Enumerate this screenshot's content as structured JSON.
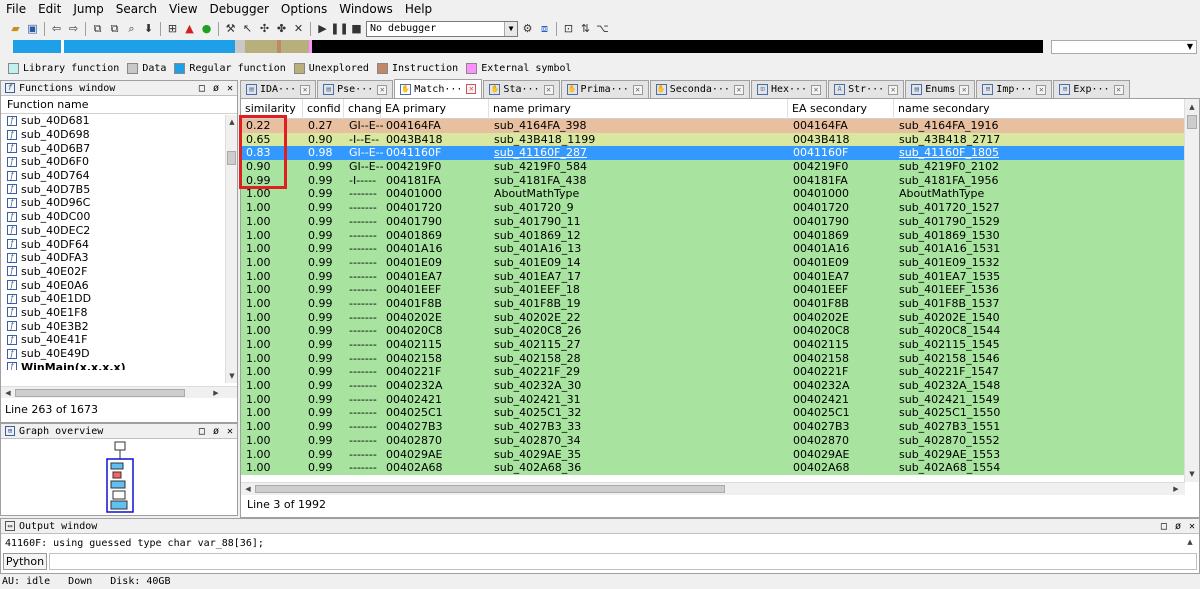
{
  "menu": [
    "File",
    "Edit",
    "Jump",
    "Search",
    "View",
    "Debugger",
    "Options",
    "Windows",
    "Help"
  ],
  "toolbar": {
    "debugger_value": "No debugger"
  },
  "colors": {
    "library_function": "#c0f0f0",
    "data": "#c8c8c8",
    "regular_function": "#1ea0e8",
    "unexplored": "#b8b07c",
    "instruction": "#c08868",
    "external_symbol": "#ff90ff",
    "row_green": "#a8e4a0",
    "row_orange": "#e8c0a0",
    "row_yellow": "#d8e8a0",
    "row_selected": "#3399ff",
    "highlight": "#e02020"
  },
  "legend": [
    {
      "label": "Library function",
      "color": "#c0f0f0"
    },
    {
      "label": "Data",
      "color": "#c8c8c8"
    },
    {
      "label": "Regular function",
      "color": "#1ea0e8"
    },
    {
      "label": "Unexplored",
      "color": "#b8b07c"
    },
    {
      "label": "Instruction",
      "color": "#c08868"
    },
    {
      "label": "External symbol",
      "color": "#ff90ff"
    }
  ],
  "functions_panel": {
    "title": "Functions window",
    "column": "Function name",
    "items": [
      "sub_40D681",
      "sub_40D698",
      "sub_40D6B7",
      "sub_40D6F0",
      "sub_40D764",
      "sub_40D7B5",
      "sub_40D96C",
      "sub_40DC00",
      "sub_40DEC2",
      "sub_40DF64",
      "sub_40DFA3",
      "sub_40E02F",
      "sub_40E0A6",
      "sub_40E1DD",
      "sub_40E1F8",
      "sub_40E3B2",
      "sub_40E41F",
      "sub_40E49D",
      "WinMain(x,x,x,x)"
    ],
    "status": "Line 263 of 1673"
  },
  "graph_panel": {
    "title": "Graph overview"
  },
  "tabs": [
    {
      "label": "IDA···",
      "icon": "ida-view-icon",
      "active": false
    },
    {
      "label": "Pse···",
      "icon": "pseudocode-icon",
      "active": false
    },
    {
      "label": "Match···",
      "icon": "match-icon",
      "active": true
    },
    {
      "label": "Sta···",
      "icon": "statistics-icon",
      "active": false
    },
    {
      "label": "Prima···",
      "icon": "primary-icon",
      "active": false
    },
    {
      "label": "Seconda···",
      "icon": "secondary-icon",
      "active": false
    },
    {
      "label": "Hex···",
      "icon": "hex-icon",
      "active": false
    },
    {
      "label": "Str···",
      "icon": "strings-icon",
      "active": false
    },
    {
      "label": "Enums",
      "icon": "enums-icon",
      "active": false
    },
    {
      "label": "Imp···",
      "icon": "imports-icon",
      "active": false
    },
    {
      "label": "Exp···",
      "icon": "exports-icon",
      "active": false
    }
  ],
  "match_table": {
    "columns": [
      "similarity",
      "confid",
      "chang",
      "EA primary",
      "name primary",
      "EA secondary",
      "name secondary"
    ],
    "rows": [
      {
        "similarity": "0.22",
        "confid": "0.27",
        "chang": "GI--E--",
        "ea_primary": "004164FA",
        "name_primary": "sub_4164FA_398",
        "ea_secondary": "004164FA",
        "name_secondary": "sub_4164FA_1916",
        "color": "orange"
      },
      {
        "similarity": "0.65",
        "confid": "0.90",
        "chang": "-I--E--",
        "ea_primary": "0043B418",
        "name_primary": "sub_43B418_1199",
        "ea_secondary": "0043B418",
        "name_secondary": "sub_43B418_2717",
        "color": "yellow"
      },
      {
        "similarity": "0.83",
        "confid": "0.98",
        "chang": "GI--E--",
        "ea_primary": "0041160F",
        "name_primary": "sub_41160F_287",
        "ea_secondary": "0041160F",
        "name_secondary": "sub_41160F_1805",
        "color": "selected"
      },
      {
        "similarity": "0.90",
        "confid": "0.99",
        "chang": "GI--E--",
        "ea_primary": "004219F0",
        "name_primary": "sub_4219F0_584",
        "ea_secondary": "004219F0",
        "name_secondary": "sub_4219F0_2102",
        "color": "green"
      },
      {
        "similarity": "0.99",
        "confid": "0.99",
        "chang": "-I-----",
        "ea_primary": "004181FA",
        "name_primary": "sub_4181FA_438",
        "ea_secondary": "004181FA",
        "name_secondary": "sub_4181FA_1956",
        "color": "green"
      },
      {
        "similarity": "1.00",
        "confid": "0.99",
        "chang": "-------",
        "ea_primary": "00401000",
        "name_primary": "AboutMathType",
        "ea_secondary": "00401000",
        "name_secondary": "AboutMathType",
        "color": "green"
      },
      {
        "similarity": "1.00",
        "confid": "0.99",
        "chang": "-------",
        "ea_primary": "00401720",
        "name_primary": "sub_401720_9",
        "ea_secondary": "00401720",
        "name_secondary": "sub_401720_1527",
        "color": "green"
      },
      {
        "similarity": "1.00",
        "confid": "0.99",
        "chang": "-------",
        "ea_primary": "00401790",
        "name_primary": "sub_401790_11",
        "ea_secondary": "00401790",
        "name_secondary": "sub_401790_1529",
        "color": "green"
      },
      {
        "similarity": "1.00",
        "confid": "0.99",
        "chang": "-------",
        "ea_primary": "00401869",
        "name_primary": "sub_401869_12",
        "ea_secondary": "00401869",
        "name_secondary": "sub_401869_1530",
        "color": "green"
      },
      {
        "similarity": "1.00",
        "confid": "0.99",
        "chang": "-------",
        "ea_primary": "00401A16",
        "name_primary": "sub_401A16_13",
        "ea_secondary": "00401A16",
        "name_secondary": "sub_401A16_1531",
        "color": "green"
      },
      {
        "similarity": "1.00",
        "confid": "0.99",
        "chang": "-------",
        "ea_primary": "00401E09",
        "name_primary": "sub_401E09_14",
        "ea_secondary": "00401E09",
        "name_secondary": "sub_401E09_1532",
        "color": "green"
      },
      {
        "similarity": "1.00",
        "confid": "0.99",
        "chang": "-------",
        "ea_primary": "00401EA7",
        "name_primary": "sub_401EA7_17",
        "ea_secondary": "00401EA7",
        "name_secondary": "sub_401EA7_1535",
        "color": "green"
      },
      {
        "similarity": "1.00",
        "confid": "0.99",
        "chang": "-------",
        "ea_primary": "00401EEF",
        "name_primary": "sub_401EEF_18",
        "ea_secondary": "00401EEF",
        "name_secondary": "sub_401EEF_1536",
        "color": "green"
      },
      {
        "similarity": "1.00",
        "confid": "0.99",
        "chang": "-------",
        "ea_primary": "00401F8B",
        "name_primary": "sub_401F8B_19",
        "ea_secondary": "00401F8B",
        "name_secondary": "sub_401F8B_1537",
        "color": "green"
      },
      {
        "similarity": "1.00",
        "confid": "0.99",
        "chang": "-------",
        "ea_primary": "0040202E",
        "name_primary": "sub_40202E_22",
        "ea_secondary": "0040202E",
        "name_secondary": "sub_40202E_1540",
        "color": "green"
      },
      {
        "similarity": "1.00",
        "confid": "0.99",
        "chang": "-------",
        "ea_primary": "004020C8",
        "name_primary": "sub_4020C8_26",
        "ea_secondary": "004020C8",
        "name_secondary": "sub_4020C8_1544",
        "color": "green"
      },
      {
        "similarity": "1.00",
        "confid": "0.99",
        "chang": "-------",
        "ea_primary": "00402115",
        "name_primary": "sub_402115_27",
        "ea_secondary": "00402115",
        "name_secondary": "sub_402115_1545",
        "color": "green"
      },
      {
        "similarity": "1.00",
        "confid": "0.99",
        "chang": "-------",
        "ea_primary": "00402158",
        "name_primary": "sub_402158_28",
        "ea_secondary": "00402158",
        "name_secondary": "sub_402158_1546",
        "color": "green"
      },
      {
        "similarity": "1.00",
        "confid": "0.99",
        "chang": "-------",
        "ea_primary": "0040221F",
        "name_primary": "sub_40221F_29",
        "ea_secondary": "0040221F",
        "name_secondary": "sub_40221F_1547",
        "color": "green"
      },
      {
        "similarity": "1.00",
        "confid": "0.99",
        "chang": "-------",
        "ea_primary": "0040232A",
        "name_primary": "sub_40232A_30",
        "ea_secondary": "0040232A",
        "name_secondary": "sub_40232A_1548",
        "color": "green"
      },
      {
        "similarity": "1.00",
        "confid": "0.99",
        "chang": "-------",
        "ea_primary": "00402421",
        "name_primary": "sub_402421_31",
        "ea_secondary": "00402421",
        "name_secondary": "sub_402421_1549",
        "color": "green"
      },
      {
        "similarity": "1.00",
        "confid": "0.99",
        "chang": "-------",
        "ea_primary": "004025C1",
        "name_primary": "sub_4025C1_32",
        "ea_secondary": "004025C1",
        "name_secondary": "sub_4025C1_1550",
        "color": "green"
      },
      {
        "similarity": "1.00",
        "confid": "0.99",
        "chang": "-------",
        "ea_primary": "004027B3",
        "name_primary": "sub_4027B3_33",
        "ea_secondary": "004027B3",
        "name_secondary": "sub_4027B3_1551",
        "color": "green"
      },
      {
        "similarity": "1.00",
        "confid": "0.99",
        "chang": "-------",
        "ea_primary": "00402870",
        "name_primary": "sub_402870_34",
        "ea_secondary": "00402870",
        "name_secondary": "sub_402870_1552",
        "color": "green"
      },
      {
        "similarity": "1.00",
        "confid": "0.99",
        "chang": "-------",
        "ea_primary": "004029AE",
        "name_primary": "sub_4029AE_35",
        "ea_secondary": "004029AE",
        "name_secondary": "sub_4029AE_1553",
        "color": "green"
      },
      {
        "similarity": "1.00",
        "confid": "0.99",
        "chang": "-------",
        "ea_primary": "00402A68",
        "name_primary": "sub_402A68_36",
        "ea_secondary": "00402A68",
        "name_secondary": "sub_402A68_1554",
        "color": "green"
      }
    ],
    "status": "Line 3 of 1992"
  },
  "output": {
    "title": "Output window",
    "line": "41160F: using guessed type char var_88[36];",
    "python_button": "Python"
  },
  "statusbar": {
    "mode": "AU:  idle",
    "direction": "Down",
    "disk": "Disk: 40GB"
  }
}
